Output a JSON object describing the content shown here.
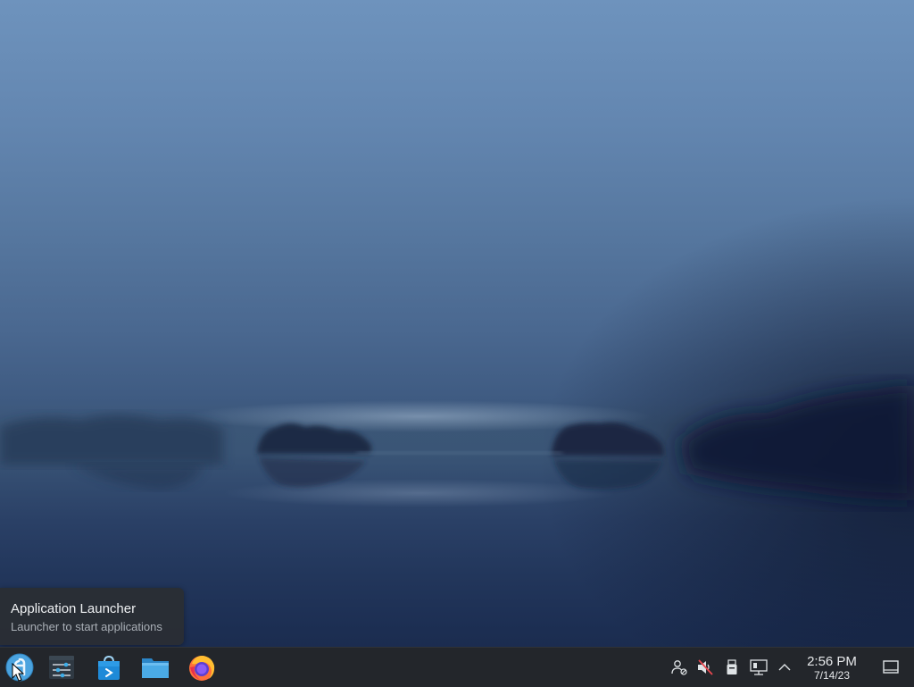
{
  "tooltip": {
    "title": "Application Launcher",
    "subtitle": "Launcher to start applications"
  },
  "taskbar": {
    "launcher": {
      "icon": "kde-launcher-icon"
    },
    "pinned_apps": [
      {
        "name": "system-settings",
        "icon": "sliders-icon"
      },
      {
        "name": "discover",
        "icon": "shopping-bag-icon"
      },
      {
        "name": "file-manager",
        "icon": "folder-icon"
      },
      {
        "name": "firefox",
        "icon": "firefox-icon"
      }
    ],
    "tray": [
      {
        "name": "user-status",
        "icon": "person-icon"
      },
      {
        "name": "audio",
        "icon": "speaker-muted-icon"
      },
      {
        "name": "storage",
        "icon": "usb-drive-icon"
      },
      {
        "name": "network",
        "icon": "network-wired-icon"
      },
      {
        "name": "expand",
        "icon": "chevron-up-icon"
      }
    ],
    "clock": {
      "time": "2:56 PM",
      "date": "7/14/23"
    },
    "show_desktop": {
      "icon": "show-desktop-icon"
    }
  },
  "colors": {
    "taskbar_bg": "#23262b",
    "tooltip_bg": "#2a2e34",
    "launcher_blue": "#3daee9",
    "folder_blue": "#3f9fe0"
  }
}
